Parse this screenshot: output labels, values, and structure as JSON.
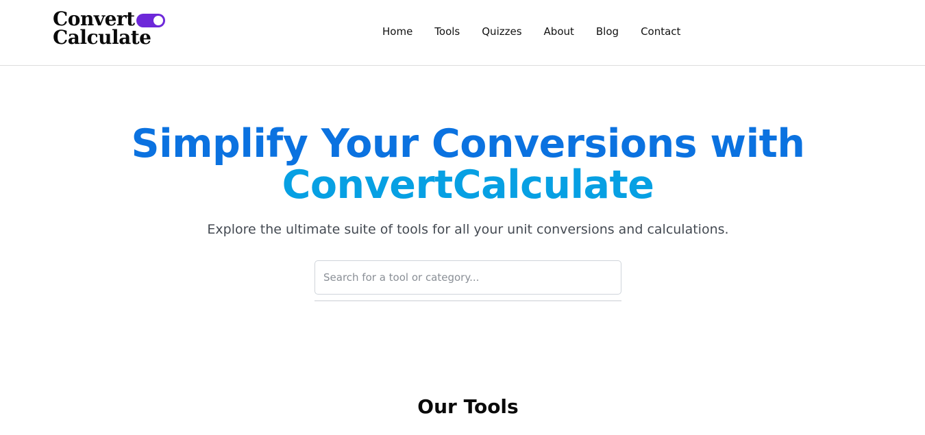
{
  "header": {
    "logo": {
      "line1": "Convert",
      "line2": "Calculate",
      "toggle_color": "#6d28d9"
    },
    "nav": [
      {
        "label": "Home"
      },
      {
        "label": "Tools"
      },
      {
        "label": "Quizzes"
      },
      {
        "label": "About"
      },
      {
        "label": "Blog"
      },
      {
        "label": "Contact"
      }
    ]
  },
  "hero": {
    "title_line1": "Simplify Your Conversions with",
    "title_line2": "ConvertCalculate",
    "title_color_1": "#0b72e0",
    "title_color_2": "#07a0e3",
    "subtitle": "Explore the ultimate suite of tools for all your unit conversions and calculations.",
    "search": {
      "placeholder": "Search for a tool or category...",
      "value": ""
    }
  },
  "tools_section": {
    "heading": "Our Tools"
  }
}
